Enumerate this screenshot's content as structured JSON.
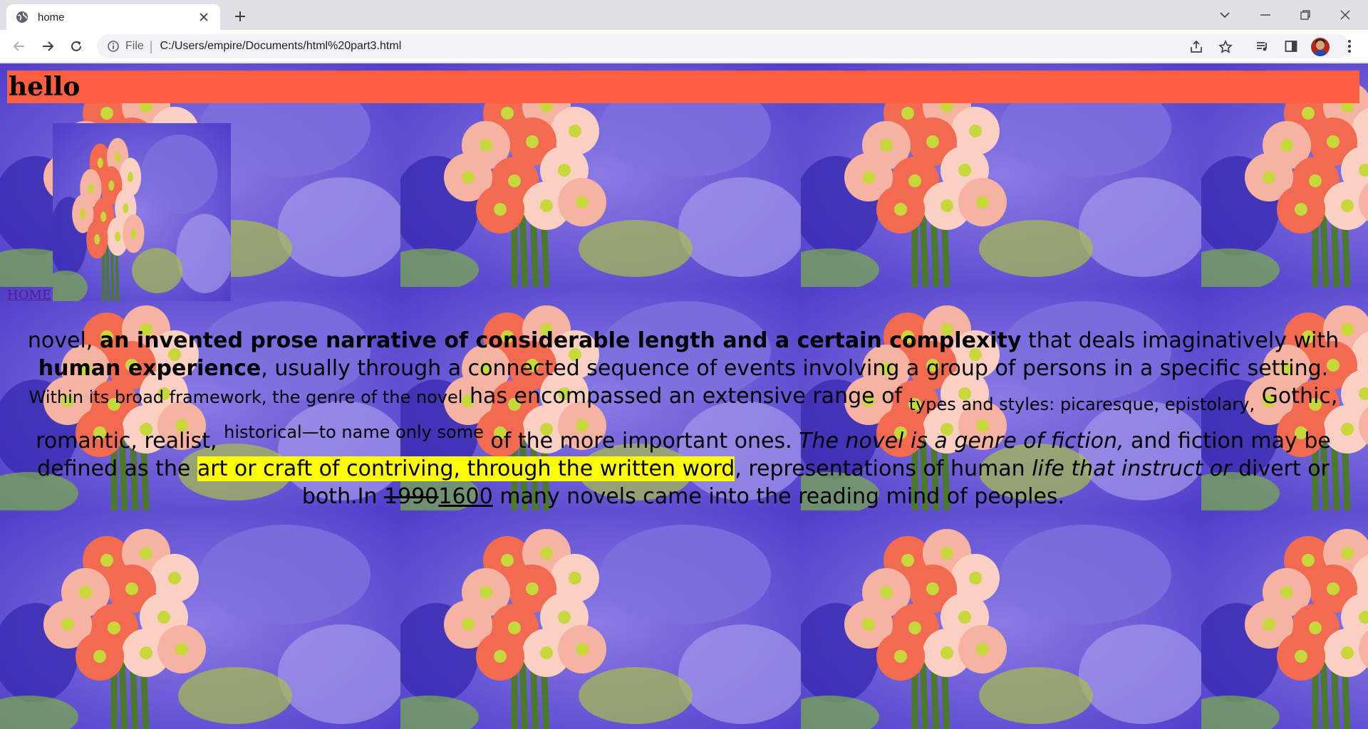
{
  "browser": {
    "tab_title": "home",
    "omnibox_scheme": "File",
    "omnibox_url": "C:/Users/empire/Documents/html%20part3.html"
  },
  "page": {
    "heading": "hello",
    "home_link": "HOME",
    "article": {
      "p1": "novel, ",
      "b1": "an invented prose narrative of considerable length and a certain complexity",
      "p2": " that deals imaginatively with ",
      "b2": "human experience",
      "p3": ", usually through a connected sequence of events involving a group of persons in a specific setting. ",
      "small1": "Within its broad framework, the genre of the novel",
      "p4": " has encompassed an extensive range of ",
      "sub1": "types and styles: picaresque, epistolary,",
      "p5": " Gothic, romantic, realist, ",
      "sup1": "historical—to name only some",
      "p6": " of the more important ones. ",
      "em1": "The novel is a genre of fiction,",
      "p7": " and fiction may be defined as the ",
      "mark1": "art or craft of contriving, through the written word",
      "p8": ", representations of human ",
      "em2": "life that instruct or",
      "p9": " divert or both.In ",
      "del1": "1990",
      "ins1": "1600",
      "p10": " many novels came into the reading mind of peoples."
    }
  }
}
